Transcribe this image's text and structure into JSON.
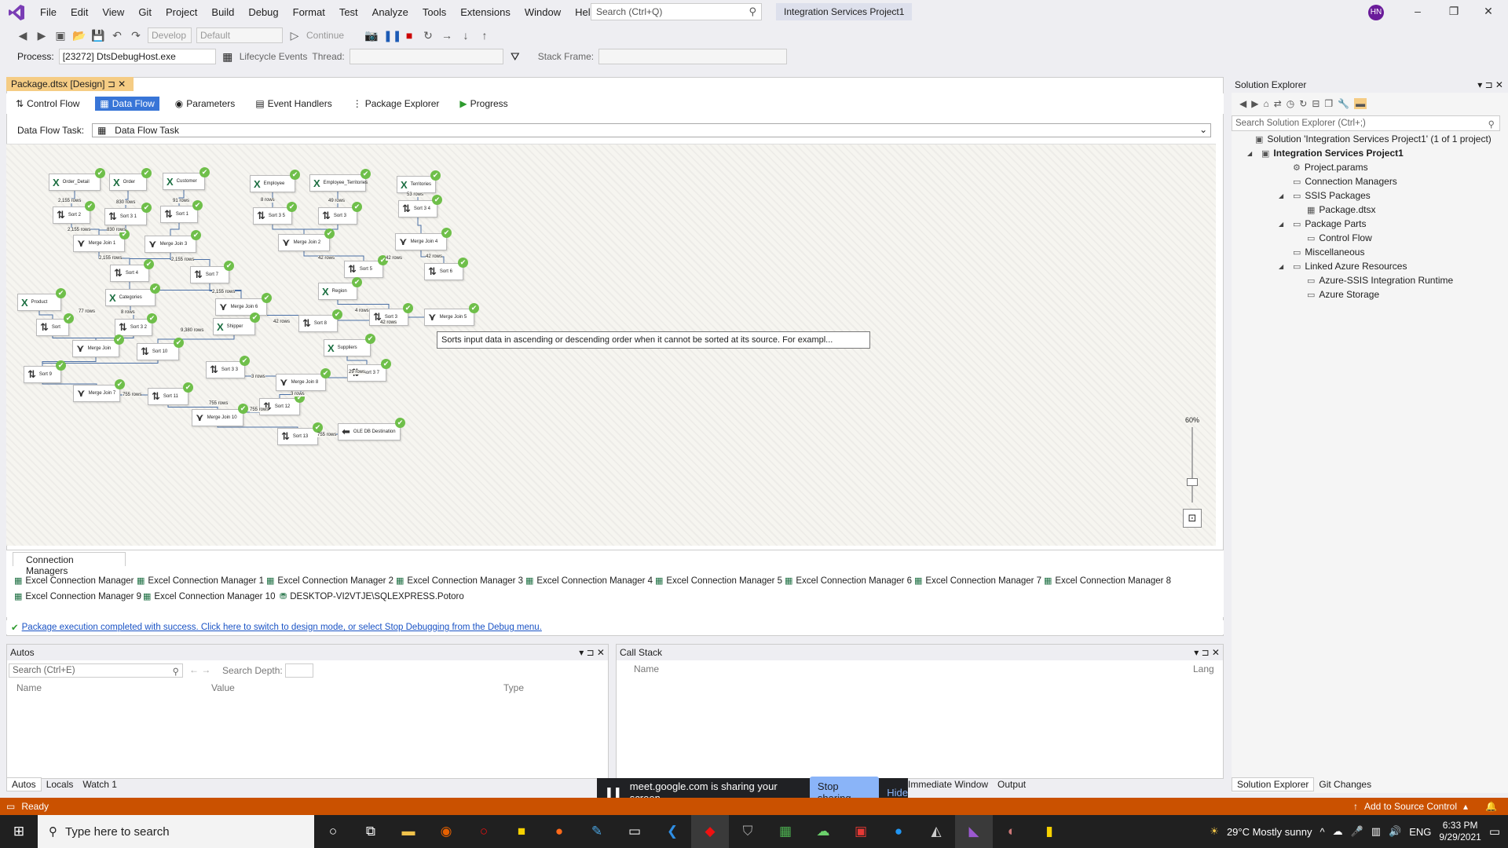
{
  "menu": [
    "File",
    "Edit",
    "View",
    "Git",
    "Project",
    "Build",
    "Debug",
    "Format",
    "Test",
    "Analyze",
    "Tools",
    "Extensions",
    "Window",
    "Help"
  ],
  "search_placeholder": "Search (Ctrl+Q)",
  "project_title": "Integration Services Project1",
  "avatar_initials": "HN",
  "toolbar": {
    "config": "Develop",
    "platform": "Default",
    "continue": "Continue"
  },
  "debug_bar": {
    "process_label": "Process:",
    "process_value": "[23272] DtsDebugHost.exe",
    "lifecycle": "Lifecycle Events",
    "thread_label": "Thread:",
    "stackframe_label": "Stack Frame:"
  },
  "doc_tab": "Package.dtsx [Design]",
  "design_tabs": [
    "Control Flow",
    "Data Flow",
    "Parameters",
    "Event Handlers",
    "Package Explorer",
    "Progress"
  ],
  "dft_label": "Data Flow Task:",
  "dft_value": "Data Flow Task",
  "nodes": [
    {
      "label": "Order_Detail",
      "kind": "excel"
    },
    {
      "label": "Order",
      "kind": "excel"
    },
    {
      "label": "Customer",
      "kind": "excel"
    },
    {
      "label": "Employee",
      "kind": "excel"
    },
    {
      "label": "Employee_Territories",
      "kind": "excel"
    },
    {
      "label": "Territories",
      "kind": "excel"
    },
    {
      "label": "Sort 2",
      "kind": "sort"
    },
    {
      "label": "Sort 3 1",
      "kind": "sort"
    },
    {
      "label": "Sort 1",
      "kind": "sort"
    },
    {
      "label": "Sort 3 5",
      "kind": "sort"
    },
    {
      "label": "Sort 3",
      "kind": "sort"
    },
    {
      "label": "Sort 3 4",
      "kind": "sort"
    },
    {
      "label": "Merge Join 1",
      "kind": "merge"
    },
    {
      "label": "Merge Join 3",
      "kind": "merge"
    },
    {
      "label": "Merge Join 2",
      "kind": "merge"
    },
    {
      "label": "Merge Join 4",
      "kind": "merge"
    },
    {
      "label": "Sort 4",
      "kind": "sort"
    },
    {
      "label": "Sort 7",
      "kind": "sort"
    },
    {
      "label": "Sort 5",
      "kind": "sort"
    },
    {
      "label": "Sort 6",
      "kind": "sort"
    },
    {
      "label": "Region",
      "kind": "excel"
    },
    {
      "label": "Product",
      "kind": "excel"
    },
    {
      "label": "Categories",
      "kind": "excel"
    },
    {
      "label": "Merge Join 6",
      "kind": "merge"
    },
    {
      "label": "Sort",
      "kind": "sort"
    },
    {
      "label": "Sort 3 2",
      "kind": "sort"
    },
    {
      "label": "Shipper",
      "kind": "excel"
    },
    {
      "label": "Sort 8",
      "kind": "sort"
    },
    {
      "label": "Sort 3",
      "kind": "sort"
    },
    {
      "label": "Merge Join 5",
      "kind": "merge"
    },
    {
      "label": "Merge Join",
      "kind": "merge"
    },
    {
      "label": "Sort 10",
      "kind": "sort"
    },
    {
      "label": "Suppliers",
      "kind": "excel"
    },
    {
      "label": "Sort 9",
      "kind": "sort"
    },
    {
      "label": "Sort 3 3",
      "kind": "sort"
    },
    {
      "label": "Merge Join 8",
      "kind": "merge"
    },
    {
      "label": "Sort 3 7",
      "kind": "sort"
    },
    {
      "label": "Merge Join 7",
      "kind": "merge"
    },
    {
      "label": "Sort 11",
      "kind": "sort"
    },
    {
      "label": "Sort 12",
      "kind": "sort"
    },
    {
      "label": "Merge Join 10",
      "kind": "merge"
    },
    {
      "label": "Sort 13",
      "kind": "sort"
    },
    {
      "label": "OLE DB Destination",
      "kind": "dest"
    }
  ],
  "row_labels": [
    "2,155 rows",
    "830 rows",
    "91 rows",
    "8 rows",
    "49 rows",
    "53 rows",
    "2,155 rows",
    "830 rows",
    "2,155 rows",
    "2,155 rows",
    "42 rows",
    "42 rows",
    "42 rows",
    "77 rows",
    "8 rows",
    "2,155 rows",
    "4 rows",
    "9,380 rows",
    "42 rows",
    "42 rows",
    "3 rows",
    "29 rows",
    "755 rows",
    "755 rows",
    "3 rows",
    "755 rows",
    "755 rows"
  ],
  "tooltip": "Sorts input data in ascending or descending order when it cannot be sorted at its source. For exampl...",
  "zoom": "60%",
  "conn_tab": "Connection Managers",
  "connections": [
    "Excel Connection Manager",
    "Excel Connection Manager 1",
    "Excel Connection Manager 2",
    "Excel Connection Manager 3",
    "Excel Connection Manager 4",
    "Excel Connection Manager 5",
    "Excel Connection Manager 6",
    "Excel Connection Manager 7",
    "Excel Connection Manager 8",
    "Excel Connection Manager 9",
    "Excel Connection Manager 10",
    "DESKTOP-VI2VTJE\\SQLEXPRESS.Potoro"
  ],
  "exec_message": "Package execution completed with success. Click here to switch to design mode, or select Stop Debugging from the Debug menu.",
  "solution": {
    "title": "Solution Explorer",
    "search": "Search Solution Explorer (Ctrl+;)",
    "items": [
      "Solution 'Integration Services Project1' (1 of 1 project)",
      "Integration Services Project1",
      "Project.params",
      "Connection Managers",
      "SSIS Packages",
      "Package.dtsx",
      "Package Parts",
      "Control Flow",
      "Miscellaneous",
      "Linked Azure Resources",
      "Azure-SSIS Integration Runtime",
      "Azure Storage"
    ],
    "tabs": [
      "Solution Explorer",
      "Git Changes"
    ]
  },
  "autos": {
    "title": "Autos",
    "search": "Search (Ctrl+E)",
    "depth": "Search Depth:",
    "cols": [
      "Name",
      "Value",
      "Type"
    ],
    "tabs": [
      "Autos",
      "Locals",
      "Watch 1"
    ]
  },
  "callstack": {
    "title": "Call Stack",
    "cols": [
      "Name",
      "Lang"
    ],
    "tabs": [
      "Immediate Window",
      "Output"
    ]
  },
  "share": {
    "text": "meet.google.com is sharing your screen.",
    "stop": "Stop sharing",
    "hide": "Hide"
  },
  "status": {
    "ready": "Ready",
    "source": "Add to Source Control"
  },
  "taskbar": {
    "search": "Type here to search",
    "weather": "29°C  Mostly sunny",
    "lang": "ENG",
    "time": "6:33 PM",
    "date": "9/29/2021"
  }
}
